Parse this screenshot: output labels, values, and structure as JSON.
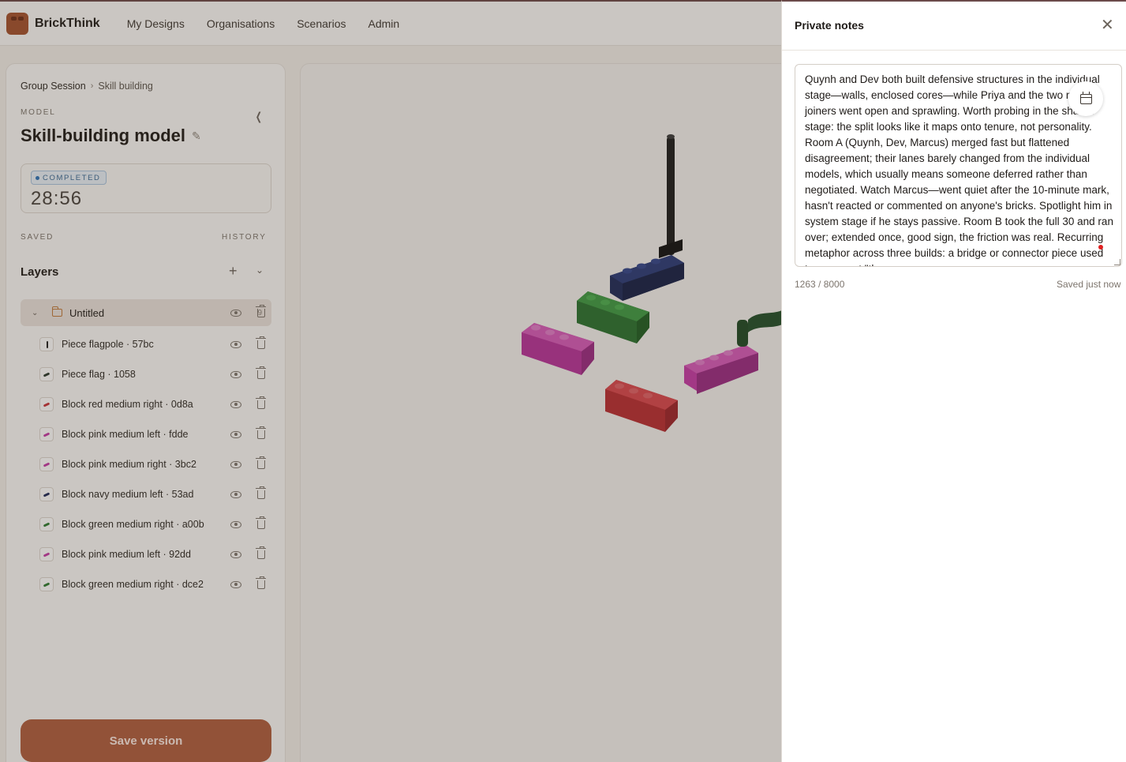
{
  "app": {
    "brand": "BrickThink",
    "nav": [
      "My Designs",
      "Organisations",
      "Scenarios",
      "Admin"
    ]
  },
  "sidebar": {
    "breadcrumb": [
      "Group Session",
      "Skill building"
    ],
    "model_label": "MODEL",
    "title": "Skill-building model",
    "status_badge": "COMPLETED",
    "timer": "28:56",
    "saved_label": "SAVED",
    "history_label": "HISTORY",
    "layers_heading": "Layers",
    "group": {
      "name": "Untitled",
      "count": "9"
    },
    "layers": [
      {
        "name": "Piece flagpole · 57bc",
        "color": "#222222"
      },
      {
        "name": "Piece flag · 1058",
        "color": "#2b3a2e"
      },
      {
        "name": "Block red medium right · 0d8a",
        "color": "#c8333a"
      },
      {
        "name": "Block pink medium left · fdde",
        "color": "#c63aa6"
      },
      {
        "name": "Block pink medium right · 3bc2",
        "color": "#c63aa6"
      },
      {
        "name": "Block navy medium left · 53ad",
        "color": "#1e2a5a"
      },
      {
        "name": "Block green medium right · a00b",
        "color": "#2e7d32"
      },
      {
        "name": "Block pink medium left · 92dd",
        "color": "#c63aa6"
      },
      {
        "name": "Block green medium right · dce2",
        "color": "#2e7d32"
      }
    ],
    "save_button": "Save version"
  },
  "notes": {
    "title": "Private notes",
    "text": "Quynh and Dev both built defensive structures in the individual stage—walls, enclosed cores—while Priya and the two new joiners went open and sprawling. Worth probing in the shared stage: the split looks like it maps onto tenure, not personality. Room A (Quynh, Dev, Marcus) merged fast but flattened disagreement; their lanes barely changed from the individual models, which usually means someone deferred rather than negotiated. Watch Marcus—went quiet after the 10-minute mark, hasn't reacted or commented on anyone's bricks. Spotlight him in system stage if he stays passive. Room B took the full 30 and ran over; extended once, good sign, the friction was real. Recurring metaphor across three builds: a bridge or connector piece used to represent \"the",
    "char_count": "1263 / 8000",
    "save_status": "Saved just now"
  },
  "colors": {
    "accent": "#b05d3f",
    "badge_blue": "#2e73b8"
  }
}
